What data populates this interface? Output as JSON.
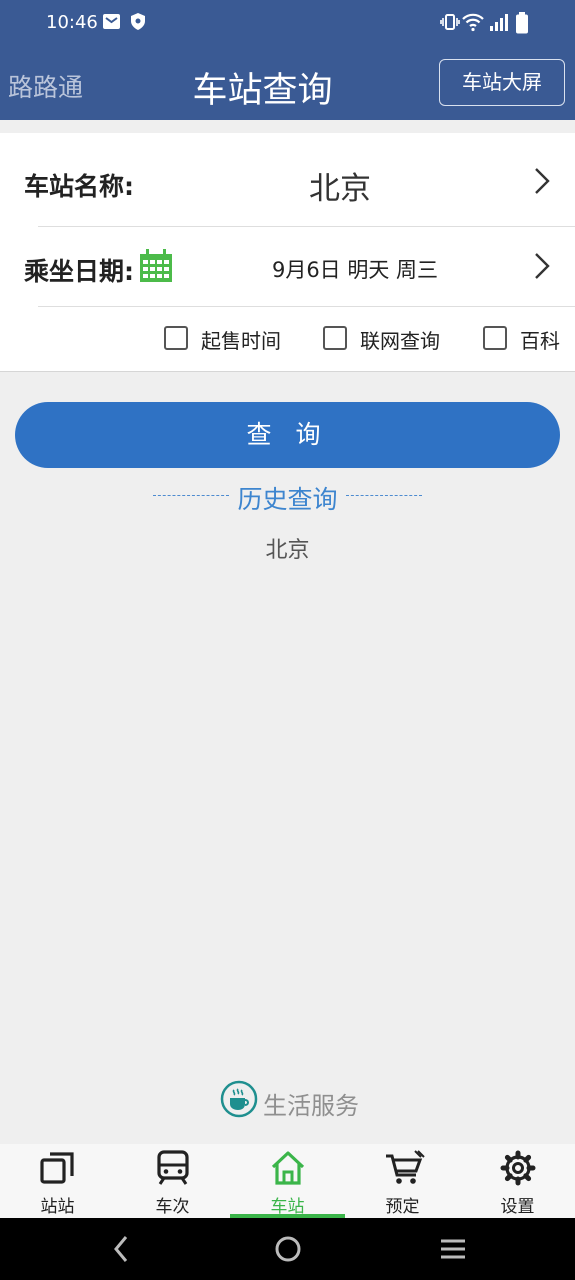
{
  "status": {
    "time": "10:46"
  },
  "header": {
    "brand": "路路通",
    "title": "车站查询",
    "screen_button": "车站大屏"
  },
  "form": {
    "station_label": "车站名称:",
    "station_value": "北京",
    "date_label": "乘坐日期:",
    "date_value": "9月6日 明天 周三",
    "options": [
      {
        "label": "起售时间",
        "checked": false
      },
      {
        "label": "联网查询",
        "checked": false
      },
      {
        "label": "百科",
        "checked": false
      }
    ]
  },
  "query_button": "查 询",
  "history": {
    "title": "历史查询",
    "items": [
      "北京"
    ]
  },
  "life_service": "生活服务",
  "tabs": [
    {
      "label": "站站",
      "icon": "windows-icon",
      "active": false
    },
    {
      "label": "车次",
      "icon": "train-icon",
      "active": false
    },
    {
      "label": "车站",
      "icon": "home-icon",
      "active": true
    },
    {
      "label": "预定",
      "icon": "cart-icon",
      "active": false
    },
    {
      "label": "设置",
      "icon": "gear-icon",
      "active": false
    }
  ],
  "colors": {
    "header": "#3a5a94",
    "primary_button": "#2f72c4",
    "active_tab": "#3bb54a",
    "history_accent": "#3d85cf"
  }
}
